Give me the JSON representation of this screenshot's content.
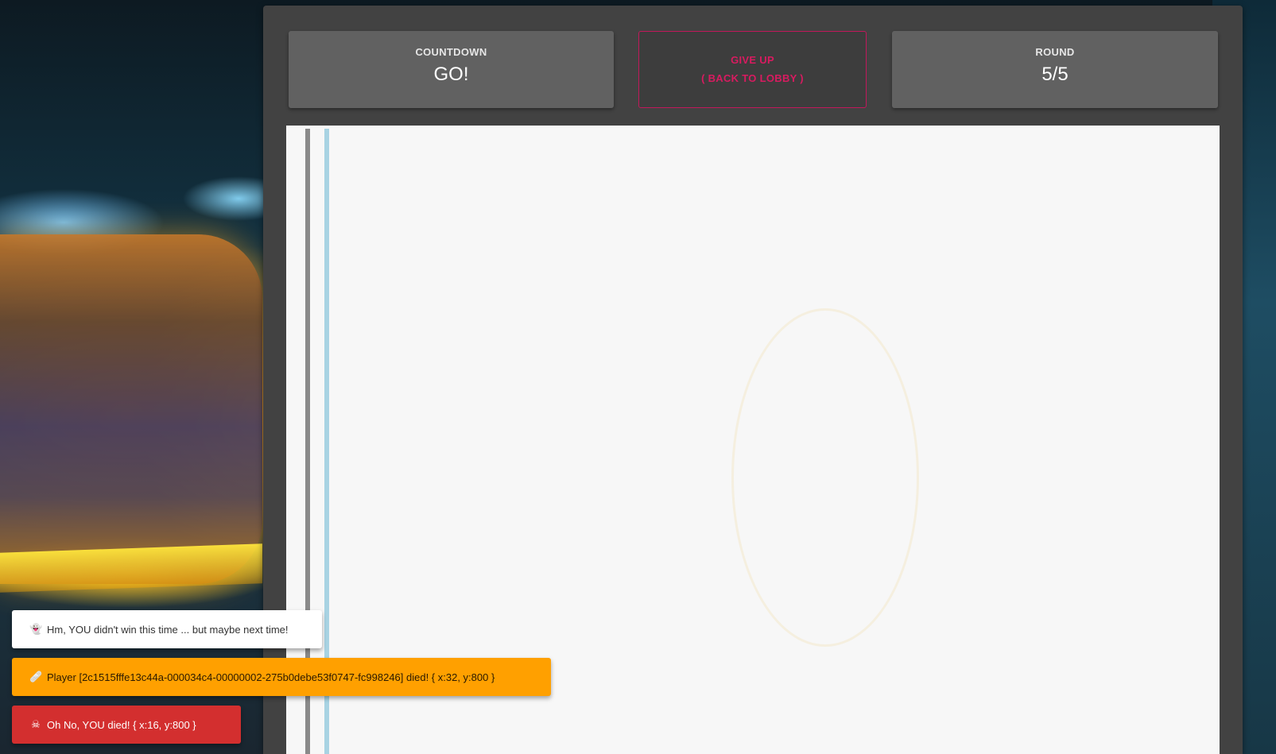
{
  "countdown": {
    "label": "COUNTDOWN",
    "value": "GO!"
  },
  "give_up": {
    "line1": "GIVE UP",
    "line2": "( BACK TO LOBBY )"
  },
  "round": {
    "label": "ROUND",
    "value": "5/5"
  },
  "board": {
    "trails": [
      {
        "color": "#8a8a8a"
      },
      {
        "color": "#a8d3e3"
      }
    ]
  },
  "toasts": [
    {
      "icon": "ghost-icon",
      "glyph": "👻",
      "text": "Hm, YOU didn't win this time ... but maybe next time!",
      "color": "#ffffff"
    },
    {
      "icon": "bandage-icon",
      "glyph": "🩹",
      "text": "Player [2c1515fffe13c44a-000034c4-00000002-275b0debe53f0747-fc998246] died! { x:32, y:800 }",
      "color": "#ffa000"
    },
    {
      "icon": "skull-icon",
      "glyph": "☠",
      "text": "Oh No, YOU died! { x:16, y:800 }",
      "color": "#d32f2f"
    }
  ]
}
